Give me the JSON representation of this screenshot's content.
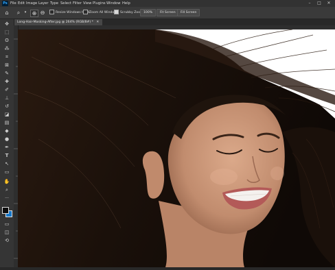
{
  "app": {
    "logo": "Ps"
  },
  "menubar": {
    "items": [
      "File",
      "Edit",
      "Image",
      "Layer",
      "Type",
      "Select",
      "Filter",
      "View",
      "Plugins",
      "Window",
      "Help"
    ],
    "window_buttons": [
      "–",
      "□",
      "✕"
    ]
  },
  "options": {
    "icons": [
      "home-icon",
      "zoom-icon",
      "zoom-in-icon",
      "zoom-out-icon"
    ],
    "resize_windows": "Resize Windows to Fit",
    "zoom_all_windows": "Zoom All Windows",
    "scrubby_zoom": "Scrubby Zoom",
    "zoom_level": "100%",
    "fit_screen": "Fit Screen",
    "fill_screen": "Fill Screen"
  },
  "document": {
    "tab_label": "Long-Hair-Masking-After.jpg @ 264% (RGB/8#) *",
    "tab_close": "✕"
  },
  "tools": {
    "icons": [
      "move-tool-icon",
      "marquee-tool-icon",
      "lasso-tool-icon",
      "magic-wand-tool-icon",
      "crop-tool-icon",
      "frame-tool-icon",
      "eyedropper-tool-icon",
      "spot-healing-tool-icon",
      "brush-tool-icon",
      "clone-stamp-tool-icon",
      "history-brush-tool-icon",
      "eraser-tool-icon",
      "gradient-tool-icon",
      "blur-tool-icon",
      "dodge-tool-icon",
      "pen-tool-icon",
      "type-tool-icon",
      "path-selection-tool-icon",
      "rectangle-tool-icon",
      "hand-tool-icon",
      "zoom-tool-icon",
      "more-tools-icon"
    ],
    "glyphs": [
      "✥",
      "⬚",
      "ʘ",
      "⁂",
      "⌗",
      "⊠",
      "✎",
      "✚",
      "✐",
      "⊥",
      "↺",
      "◪",
      "▤",
      "◆",
      "●",
      "✒",
      "T",
      "↖",
      "▭",
      "✋",
      "⌕",
      "···"
    ],
    "foreground_color": "#0c0c0c",
    "background_color": "#1677c9",
    "extra_glyphs": [
      "▭",
      "◫",
      "⟲"
    ]
  },
  "colors": {
    "menubar": "#323232",
    "optionbar": "#3a3a3a",
    "toolbar": "#353535",
    "workspace": "#282828",
    "hair": "#1c120c",
    "skin": "#c59376"
  }
}
